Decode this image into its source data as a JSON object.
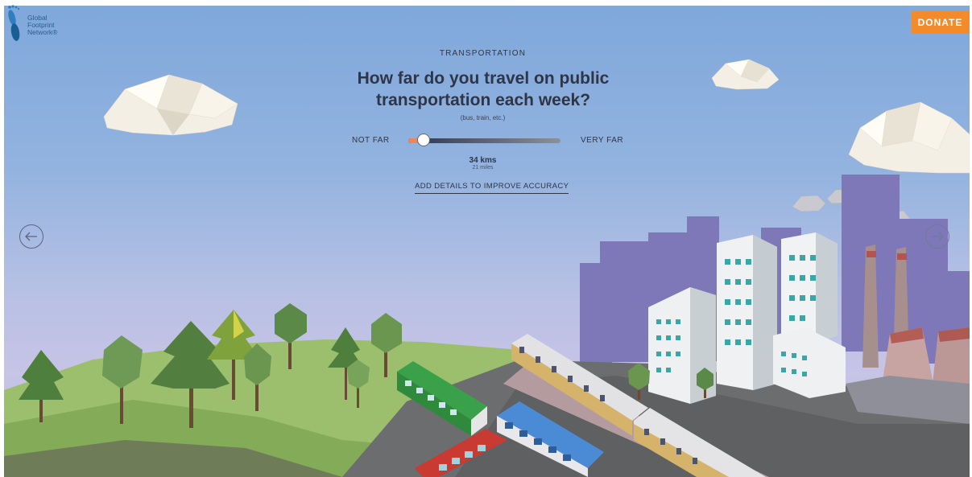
{
  "brand": {
    "logo_lines": [
      "Global",
      "Footprint",
      "Network®"
    ],
    "logo_icon": "footprint-icon"
  },
  "header": {
    "donate_label": "DONATE"
  },
  "question": {
    "category": "TRANSPORTATION",
    "title": "How far do you travel on public transportation each week?",
    "subtitle": "(bus, train, etc.)"
  },
  "slider": {
    "left_label": "NOT FAR",
    "right_label": "VERY FAR",
    "position_fraction": 0.1,
    "value_primary": "34 kms",
    "value_secondary": "21 miles"
  },
  "details_link": "ADD DETAILS TO IMPROVE ACCURACY",
  "navigation": {
    "prev_icon": "arrow-left-icon",
    "next_icon": "arrow-right-icon"
  },
  "colors": {
    "donate": "#f48b2a",
    "slider_fill": "#f0845a",
    "text_dark": "#2e3547"
  }
}
